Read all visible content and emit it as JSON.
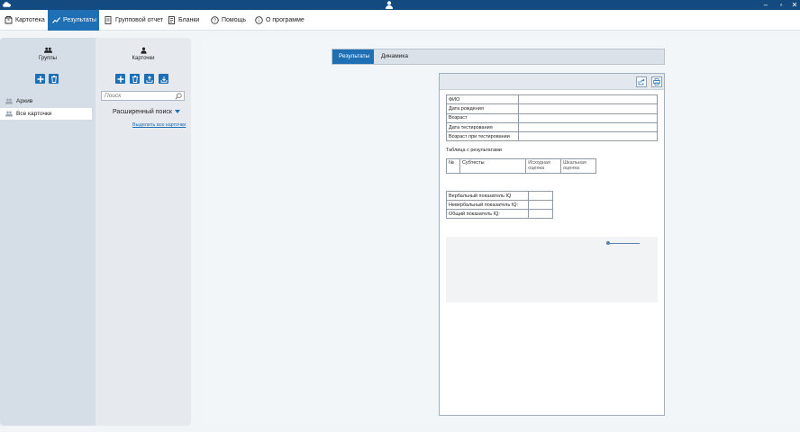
{
  "menu": {
    "items": [
      {
        "label": "Картотека",
        "icon": "cabinet-icon"
      },
      {
        "label": "Результаты",
        "icon": "chart-line-icon",
        "active": true
      },
      {
        "label": "Групповой отчет",
        "icon": "group-report-icon"
      },
      {
        "label": "Бланки",
        "icon": "forms-icon"
      },
      {
        "label": "Помощь",
        "icon": "help-icon"
      },
      {
        "label": "О программе",
        "icon": "info-icon"
      }
    ]
  },
  "groups": {
    "title": "Группы",
    "items": [
      {
        "label": "Архив"
      },
      {
        "label": "Все карточки",
        "selected": true
      }
    ]
  },
  "cards": {
    "title": "Карточки",
    "search_placeholder": "Поиск",
    "advanced_search": "Расширенный поиск",
    "select_all": "Выделить все карточки"
  },
  "tabs": [
    {
      "label": "Результаты",
      "active": true
    },
    {
      "label": "Динамика",
      "active": false
    }
  ],
  "report": {
    "info_rows": [
      "ФИО",
      "Дата рождения",
      "Возраст",
      "Дата тестирования",
      "Возраст при тестировании"
    ],
    "results_caption": "Таблица с результатами",
    "results_headers": [
      "№",
      "Субтесты",
      "Исходная оценка",
      "Шкальная оценка"
    ],
    "iq_rows": [
      "Вербальный показатель IQ",
      "Невербальный показатель IQ:",
      "Общий показатель IQ:"
    ]
  },
  "colors": {
    "titlebar": "#134a80",
    "accent": "#1f6fb5"
  }
}
